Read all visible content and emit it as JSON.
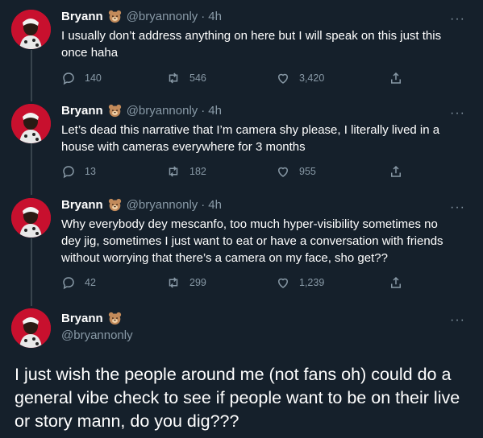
{
  "tweets": [
    {
      "name": "Bryann",
      "handle": "@bryannonly",
      "time": "4h",
      "text": "I usually don’t address anything on here but I will speak on this just this once haha",
      "replies": "140",
      "retweets": "546",
      "likes": "3,420"
    },
    {
      "name": "Bryann",
      "handle": "@bryannonly",
      "time": "4h",
      "text": "Let’s dead this narrative that I’m camera shy please, I literally lived in a house with cameras everywhere for 3 months",
      "replies": "13",
      "retweets": "182",
      "likes": "955"
    },
    {
      "name": "Bryann",
      "handle": "@bryannonly",
      "time": "4h",
      "text": "Why everybody dey mescanfo, too much hyper-visibility sometimes no dey jig, sometimes I just want to eat or have a conversation with friends without worrying that there’s a camera on my face, sho get??",
      "replies": "42",
      "retweets": "299",
      "likes": "1,239"
    }
  ],
  "main_tweet": {
    "name": "Bryann",
    "handle": "@bryannonly",
    "text": "I just wish the people around me (not fans oh) could do a general vibe check to see if people want to be on their live or story mann, do you dig???"
  },
  "separator": "·",
  "more_glyph": "···",
  "colors": {
    "background": "#15202b",
    "secondary_text": "#8899a6",
    "thread_line": "#38444d",
    "avatar_bg": "#c8102e"
  },
  "icons": [
    "bear-emoji-icon",
    "reply-icon",
    "retweet-icon",
    "like-icon",
    "share-icon",
    "more-icon"
  ]
}
